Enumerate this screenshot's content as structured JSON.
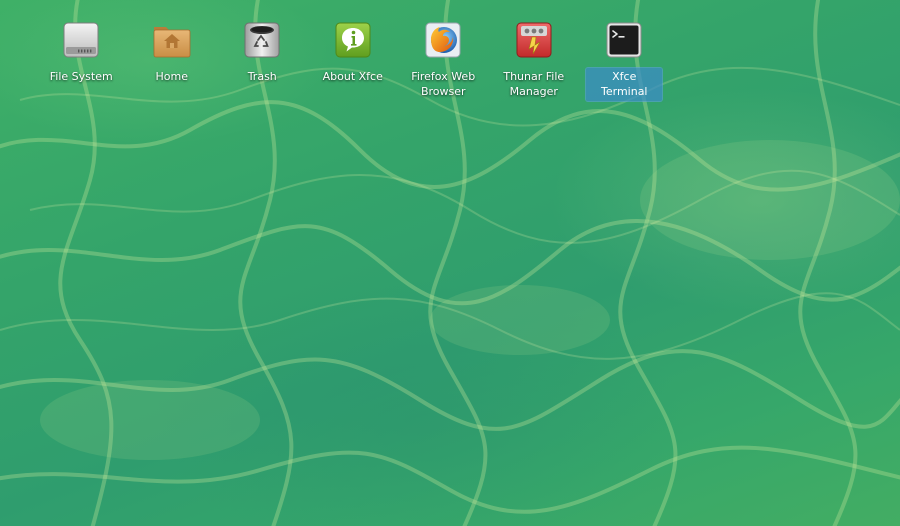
{
  "desktop": {
    "icons": [
      {
        "label": "File System",
        "icon": "drive-icon",
        "selected": false
      },
      {
        "label": "Home",
        "icon": "home-folder-icon",
        "selected": false
      },
      {
        "label": "Trash",
        "icon": "trash-icon",
        "selected": false
      },
      {
        "label": "About Xfce",
        "icon": "info-icon",
        "selected": false
      },
      {
        "label": "Firefox Web Browser",
        "icon": "firefox-icon",
        "selected": false
      },
      {
        "label": "Thunar File Manager",
        "icon": "thunar-icon",
        "selected": false
      },
      {
        "label": "Xfce Terminal",
        "icon": "terminal-icon",
        "selected": true
      }
    ]
  },
  "colors": {
    "selection": "#3c8cc8",
    "label_text": "#ffffff"
  }
}
